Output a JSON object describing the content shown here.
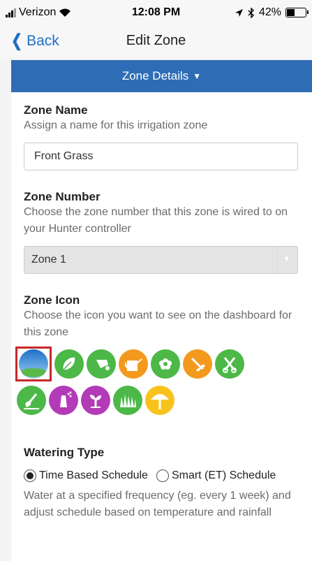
{
  "status_bar": {
    "carrier": "Verizon",
    "time": "12:08 PM",
    "battery_percent": "42%",
    "battery_level": 0.42
  },
  "nav": {
    "back_label": "Back",
    "title": "Edit Zone"
  },
  "zone_details": {
    "header_label": "Zone Details"
  },
  "zone_name": {
    "label": "Zone Name",
    "help": "Assign a name for this irrigation zone",
    "value": "Front Grass"
  },
  "zone_number": {
    "label": "Zone Number",
    "help": "Choose the zone number that this zone is wired to on your Hunter controller",
    "selected": "Zone 1"
  },
  "zone_icon": {
    "label": "Zone Icon",
    "help": "Choose the icon you want to see on the dashboard for this zone",
    "selected_icon": "sky-grass-icon",
    "icons_row1": [
      {
        "name": "sky-grass-icon",
        "color": "#3a8fd6"
      },
      {
        "name": "leaf-icon",
        "color": "#4cb848"
      },
      {
        "name": "wheelbarrow-icon",
        "color": "#4cb848"
      },
      {
        "name": "watering-can-icon",
        "color": "#f39a1e"
      },
      {
        "name": "flower-icon",
        "color": "#4cb848"
      },
      {
        "name": "rake-icon",
        "color": "#f39a1e"
      },
      {
        "name": "shears-icon",
        "color": "#4cb848"
      }
    ],
    "icons_row2": [
      {
        "name": "shovel-icon",
        "color": "#4cb848"
      },
      {
        "name": "sprinkler-icon",
        "color": "#b33bb8"
      },
      {
        "name": "sprout-icon",
        "color": "#b33bb8"
      },
      {
        "name": "grass-icon",
        "color": "#4cb848"
      },
      {
        "name": "tree-icon",
        "color": "#f8c21e"
      }
    ]
  },
  "watering_type": {
    "label": "Watering Type",
    "option_time": "Time Based Schedule",
    "option_smart": "Smart (ET) Schedule",
    "selected": "Time Based Schedule",
    "help": "Water at a specified frequency (eg. every 1 week) and adjust schedule based on temperature and rainfall"
  },
  "colors": {
    "accent": "#2e6db5",
    "link": "#1f6fc5",
    "selection_border": "#c62828"
  }
}
